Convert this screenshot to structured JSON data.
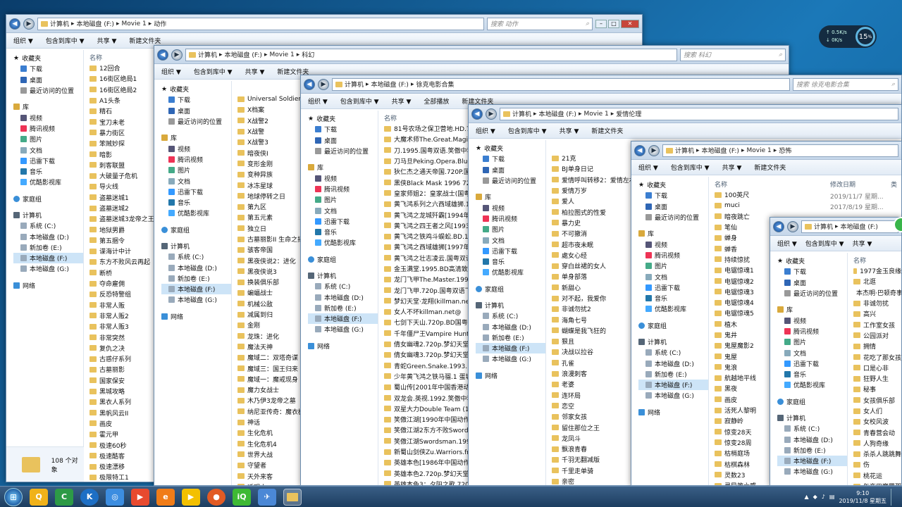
{
  "windows": [
    {
      "address": [
        "计算机",
        "本地磁盘 (F:)",
        "Movie 1",
        "动作"
      ],
      "search": "搜索 动作",
      "cmds": [
        "组织 ▼",
        "包含到库中 ▼",
        "共享 ▼",
        "新建文件夹"
      ],
      "col_name": "名称",
      "items": [
        "12回合",
        "16街区绝局1",
        "16街区绝局2",
        "A1头条",
        "精石",
        "宝刀未老",
        "暴力街区",
        "笨贼妙探",
        "暗影",
        "刺客联盟",
        "大破量子危机",
        "导火线",
        "盗墓迷城1",
        "盗墓迷城2",
        "盗墓迷城3龙帝之王",
        "地狱男爵",
        "第五捆令",
        "谍海计中计",
        "东方不败风云再起",
        "断桥",
        "夺命雇佣",
        "反恐特警组",
        "非常人贩",
        "非常人贩2",
        "非常人贩3",
        "非常突然",
        "复仇之决",
        "古惑仔系列",
        "古墓丽影",
        "国家保安",
        "黑城攻略",
        "黑衣人系列",
        "黑帆风云II",
        "画皮",
        "霍元甲",
        "极速60秒",
        "极速酷客",
        "极速漂移",
        "极限特工1",
        "极限特工2"
      ],
      "status": "108 个对象"
    },
    {
      "address": [
        "计算机",
        "本地磁盘 (F:)",
        "Movie 1",
        "科幻"
      ],
      "search": "搜索 科幻",
      "cmds": [
        "组织 ▼",
        "包含到库中 ▼",
        "共享 ▼",
        "新建文件夹"
      ],
      "items": [
        "Universal Soldiers",
        "X档案",
        "X战警2",
        "X战警",
        "X战警3",
        "暗夜侠I",
        "变形金刚",
        "变种异族",
        "冰冻星球",
        "地球停转之日",
        "第九区",
        "第五元素",
        "独立日",
        "古墓丽影II 生命之摇",
        "骇客帝国",
        "黑夜侠说2：进化",
        "黑夜侠说3",
        "换装俱乐部",
        "蝙蝠战士",
        "机械公敌",
        "减属到归",
        "金刚",
        "龙珠：进化",
        "魔法天神",
        "魔域二：双塔奇谋",
        "魔域三：国王归来",
        "魔域一：魔戒现身",
        "魔力女战士",
        "木乃伊3龙帝之墓",
        "纳尼亚传奇：魔衣橱",
        "神话",
        "生化危机",
        "生化危机4",
        "世界大战",
        "守望者",
        "天外来客",
        "透明人",
        "透明人2",
        "网络惊魂2.0"
      ]
    },
    {
      "address": [
        "计算机",
        "本地磁盘 (F:)",
        "徐克电影合集"
      ],
      "search": "搜索 徐克电影合集",
      "cmds": [
        "组织 ▼",
        "包含到库中 ▼",
        "共享 ▼",
        "全部播放",
        "新建文件夹"
      ],
      "col_name": "名称",
      "items": [
        "81号农场之保卫营地.HD.720p",
        "大魔术师The.Great.Magician",
        "刀.1995.国粤双语.笑傲中李",
        "刀马旦Peking.Opera.Blues.",
        "狄仁杰之通天帝国.720P.国粤",
        "黑侠Black Mask 1996 720p",
        "皇家师姐2：皇家战士(国粤)",
        "黄飞鸿系列之六西域雄狮.199",
        "黄飞鸿之龙城歼霸[1994年中",
        "黄飞鸿之四王者之风[1993年",
        "黄飞鸿之铁鸡斗蜈蚣.BD.128",
        "黄飞鸿之西域雄狮[1997年中",
        "黄飞鸿之壮志凌云.国粤双语.",
        "金玉满堂.1995.BD高清致敬",
        "龙门飞甲The.Master.1992.7",
        "龙门飞甲.720p.国粤双语飞线",
        "梦幻天堂·龙翔(killman.net)",
        "女人不坏killman.net@",
        "七剑下天山.720p.BD国粤双",
        "千年僵尸王Vampire Hunter",
        "倩女幽魂2.720p.梦幻天堂·龙",
        "倩女幽魂3.720p.梦幻天堂·龙",
        "青蛇Green.Snake.1993.DVD",
        "少年黄飞鸿之铁马骝.1 蛋城好",
        "蜀山传[2001年中国香港动作",
        "双龙会.英视.1992.笑傲中李",
        "双星大力Double Team (1997",
        "笑傲江湖[1990年中国动作",
        "笑傲江湖2东方不败Swordsm",
        "笑傲江湖Swordsman.1990.",
        "新蜀山剑侠Zu.Warriors.from",
        "英雄本色[1986年中国动作II",
        "英雄本色2.720p.梦幻天堂·龙",
        "英雄本色3：夕阳之歌.720p.",
        "智取威虎山.The.Taking.of.T",
        "最佳拍档1：光头神探@圣城",
        "最佳拍档3Aces.Go.Places.3"
      ]
    },
    {
      "address": [
        "计算机",
        "本地磁盘 (F:)",
        "Movie 1",
        "爱情伦理"
      ],
      "cmds": [
        "组织 ▼",
        "包含到库中 ▼",
        "共享 ▼",
        "新建文件夹"
      ],
      "items": [
        "21克",
        "BJ单身日记",
        "爱情呼叫转移2：爱情左右",
        "爱情万岁",
        "爱人",
        "柏拉图式的性爱",
        "暴力史",
        "不可撤消",
        "超市夜未眠",
        "處女心经",
        "穿白丝裙的女人",
        "单身部落",
        "新甜心",
        "对不起，我爱你",
        "非诚勿扰2",
        "海角七号",
        "蝴蝶是我飞狂的",
        "狠且",
        "决战以拉谷",
        "孔雀",
        "浪漫刺客",
        "老婆",
        "连环局",
        "恋空",
        "邻家女孩",
        "留住那位之王",
        "龙凤斗",
        "飘浪青春",
        "千羽无翻减版",
        "千里走单骑",
        "亲密",
        "傲特利亚女孩",
        "取灯",
        "色戒"
      ]
    },
    {
      "address": [
        "计算机",
        "本地磁盘 (F:)",
        "Movie 1",
        "恐怖"
      ],
      "cmds": [
        "组织 ▼",
        "包含到库中 ▼",
        "共享 ▼",
        "新建文件夹"
      ],
      "col_name": "名称",
      "col_date": "修改日期",
      "col_type": "类",
      "dates": [
        "2019/11/7 星期...",
        "2017/8/19 星期..."
      ],
      "items": [
        "100英尺",
        "muci",
        "暗夜跳亡",
        "笔仙",
        "蝉身",
        "蝉香",
        "持续惊扰",
        "电锯惊魂1",
        "电锯惊魂2",
        "电锯惊魂3",
        "电锯惊魂4",
        "电锯惊魂5",
        "植木",
        "鬼井",
        "鬼屋魔影2",
        "鬼屋",
        "鬼浪",
        "航越地平线",
        "黑夜",
        "画皮",
        "活死人黎明",
        "寂静岭",
        "惊变28天",
        "惊变28周",
        "枯梢庭场",
        "枯棋森林",
        "灵数23",
        "灵异第六感",
        "魔鬼搭车人"
      ]
    },
    {
      "address": [
        "计算机",
        "本地磁盘 (F:)"
      ],
      "cmds": [
        "组织 ▼",
        "包含到库中 ▼",
        "共享 ▼"
      ],
      "col_name": "名称",
      "items": [
        "1977金玉良缘",
        "北逛",
        "本杰明·巴顿奇事",
        "非诚勿扰",
        "高兴",
        "工作室女孩",
        "公园派对",
        "拥情",
        "花吃了那女孩",
        "口是心非",
        "狂野人生",
        "秘事",
        "女孩俱乐部",
        "女人们",
        "女校风波",
        "青春营会动",
        "人狗奇缘",
        "杀杀人跳跳舞",
        "伤",
        "桃花运",
        "午夜巴塞罗那",
        "校园兔女郎",
        "摇滚"
      ]
    }
  ],
  "sidebar": {
    "fav": "收藏夹",
    "fav_items": [
      "下载",
      "桌面",
      "最近访问的位置"
    ],
    "lib": "库",
    "lib_items": [
      "视频",
      "腾讯视频",
      "图片",
      "文档",
      "迅雷下载",
      "音乐",
      "优酷影视库"
    ],
    "home": "家庭组",
    "pc": "计算机",
    "drives": [
      "系统 (C:)",
      "本地磁盘 (D:)",
      "新加卷 (E:)",
      "本地磁盘 (F:)",
      "本地磁盘 (G:)"
    ],
    "net": "网络"
  },
  "monitor": {
    "up": "0.5",
    "down": "0",
    "unit": "K/s",
    "cpu": "15",
    "cpu_unit": "%"
  },
  "clock": {
    "time": "9:10",
    "date": "2019/11/8 星期五"
  },
  "taskbar": [
    "Q",
    "C",
    "K",
    "◎",
    "▶",
    "e",
    "▶",
    "●",
    "iQ",
    "✈"
  ]
}
